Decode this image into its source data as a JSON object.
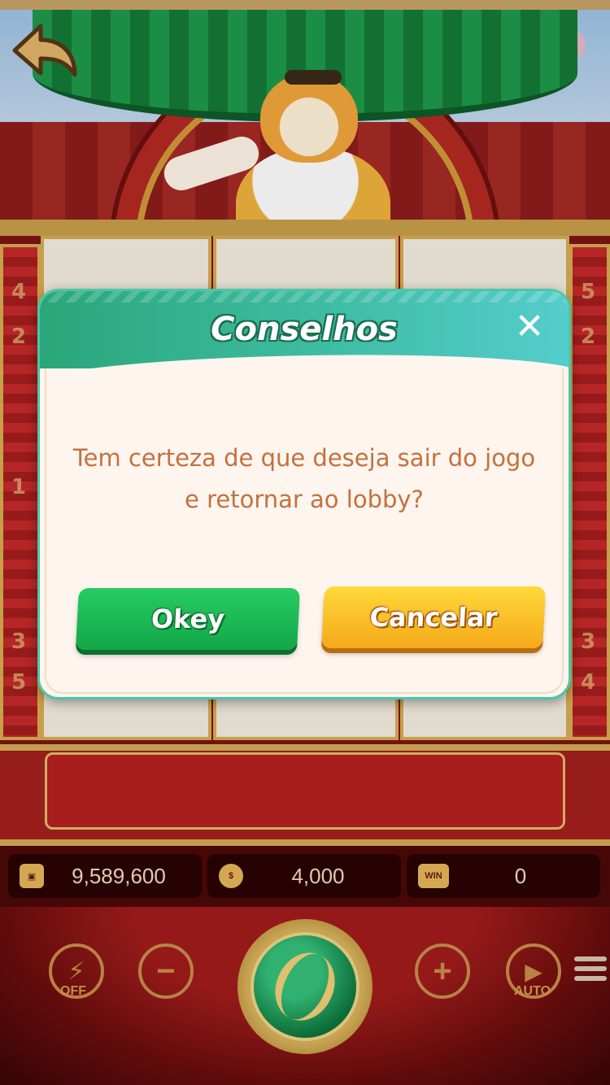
{
  "game": {
    "balance": "9,589,600",
    "bet": "4,000",
    "win": "0",
    "win_badge": "WIN",
    "turbo_label": "OFF",
    "auto_label": "AUTO",
    "minus_symbol": "−",
    "plus_symbol": "+",
    "pillar_left_numbers": [
      "4",
      "2",
      "1",
      "3",
      "5"
    ],
    "pillar_right_numbers": [
      "5",
      "2",
      "3",
      "4"
    ]
  },
  "dialog": {
    "title": "Conselhos",
    "close_symbol": "✕",
    "message_line1": "Tem certeza de que deseja sair do jogo",
    "message_line2": "e retornar ao lobby?",
    "ok_label": "Okey",
    "cancel_label": "Cancelar"
  },
  "icons": {
    "back": "back-arrow-icon",
    "wallet": "wallet-icon",
    "coins": "coins-icon",
    "win": "win-badge-icon",
    "turbo": "lightning-icon",
    "minus": "minus-icon",
    "spin": "spin-icon",
    "plus": "plus-icon",
    "auto": "play-icon",
    "menu": "hamburger-menu-icon",
    "close": "close-icon"
  },
  "colors": {
    "dialog_header": "#3dbba0",
    "message_text": "#c4713e",
    "ok_button": "#13a748",
    "cancel_button": "#f5a91a"
  }
}
